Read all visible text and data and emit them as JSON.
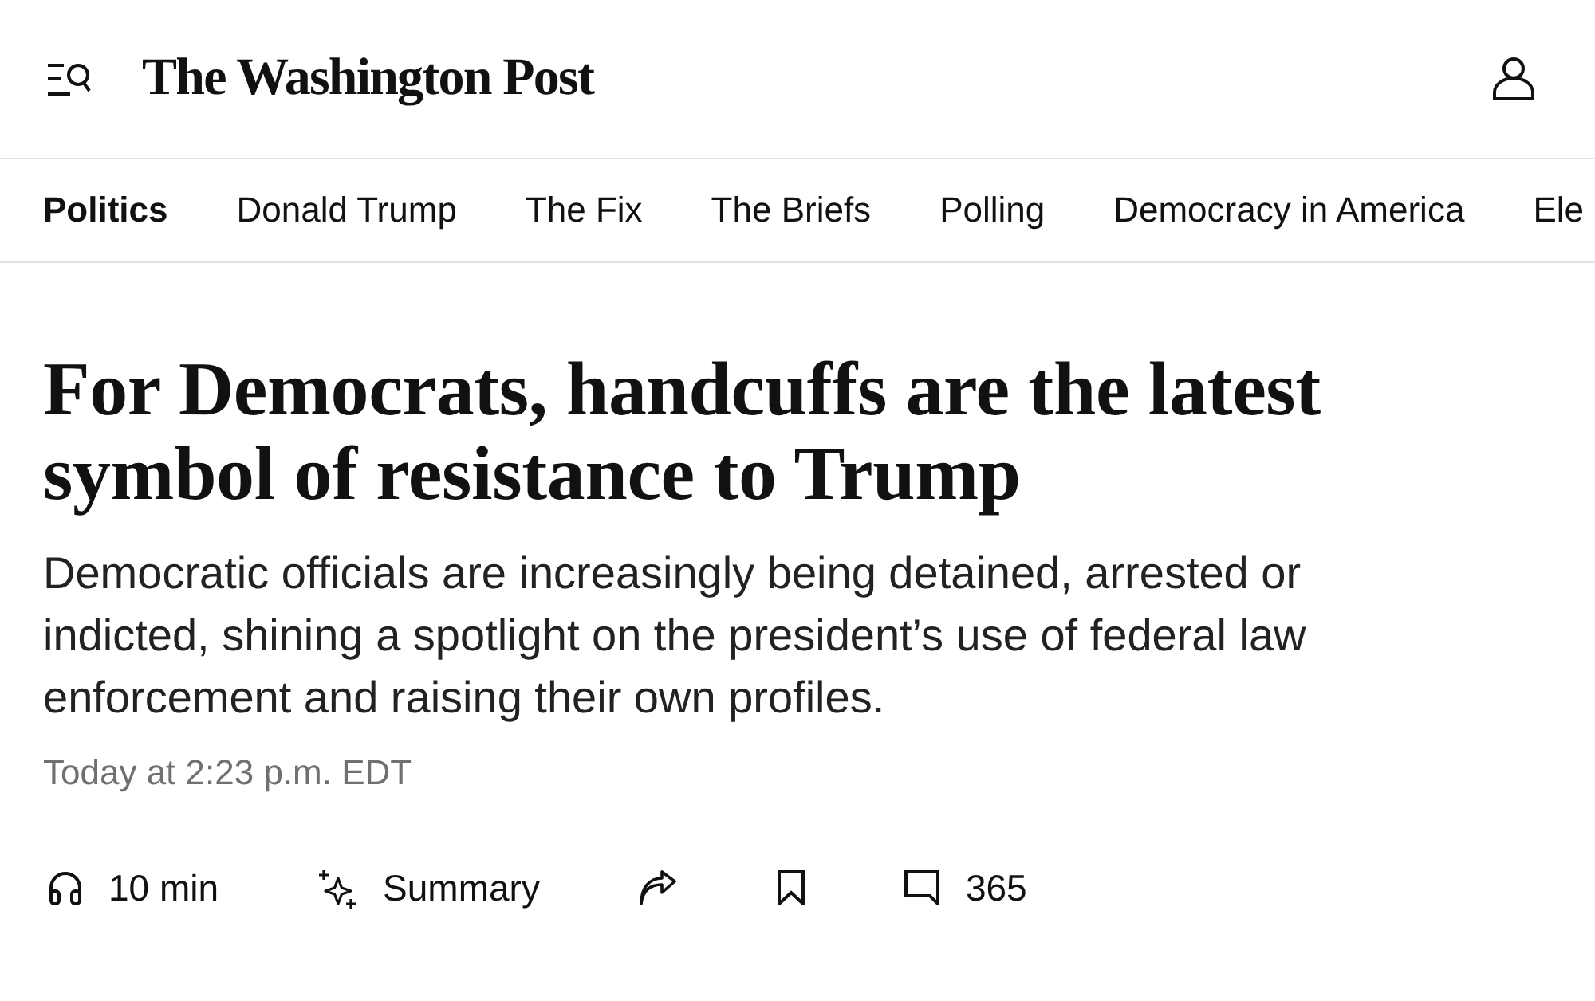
{
  "header": {
    "logo": "The Washington Post"
  },
  "nav": {
    "items": [
      {
        "label": "Politics",
        "selected": true
      },
      {
        "label": "Donald Trump",
        "selected": false
      },
      {
        "label": "The Fix",
        "selected": false
      },
      {
        "label": "The Briefs",
        "selected": false
      },
      {
        "label": "Polling",
        "selected": false
      },
      {
        "label": "Democracy in America",
        "selected": false
      },
      {
        "label": "Ele",
        "selected": false
      }
    ]
  },
  "article": {
    "headline": "For Democrats, handcuffs are the latest symbol of resistance to Trump",
    "subheadline": "Democratic officials are increasingly being detained, arrested or indicted, shining a spotlight on the president’s use of federal law enforcement and raising their own profiles.",
    "timestamp": "Today at 2:23 p.m. EDT"
  },
  "actions": [
    {
      "kind": "listen",
      "label": "10 min"
    },
    {
      "kind": "summary",
      "label": "Summary"
    },
    {
      "kind": "share"
    },
    {
      "kind": "save"
    },
    {
      "kind": "comments",
      "label": "365"
    }
  ]
}
